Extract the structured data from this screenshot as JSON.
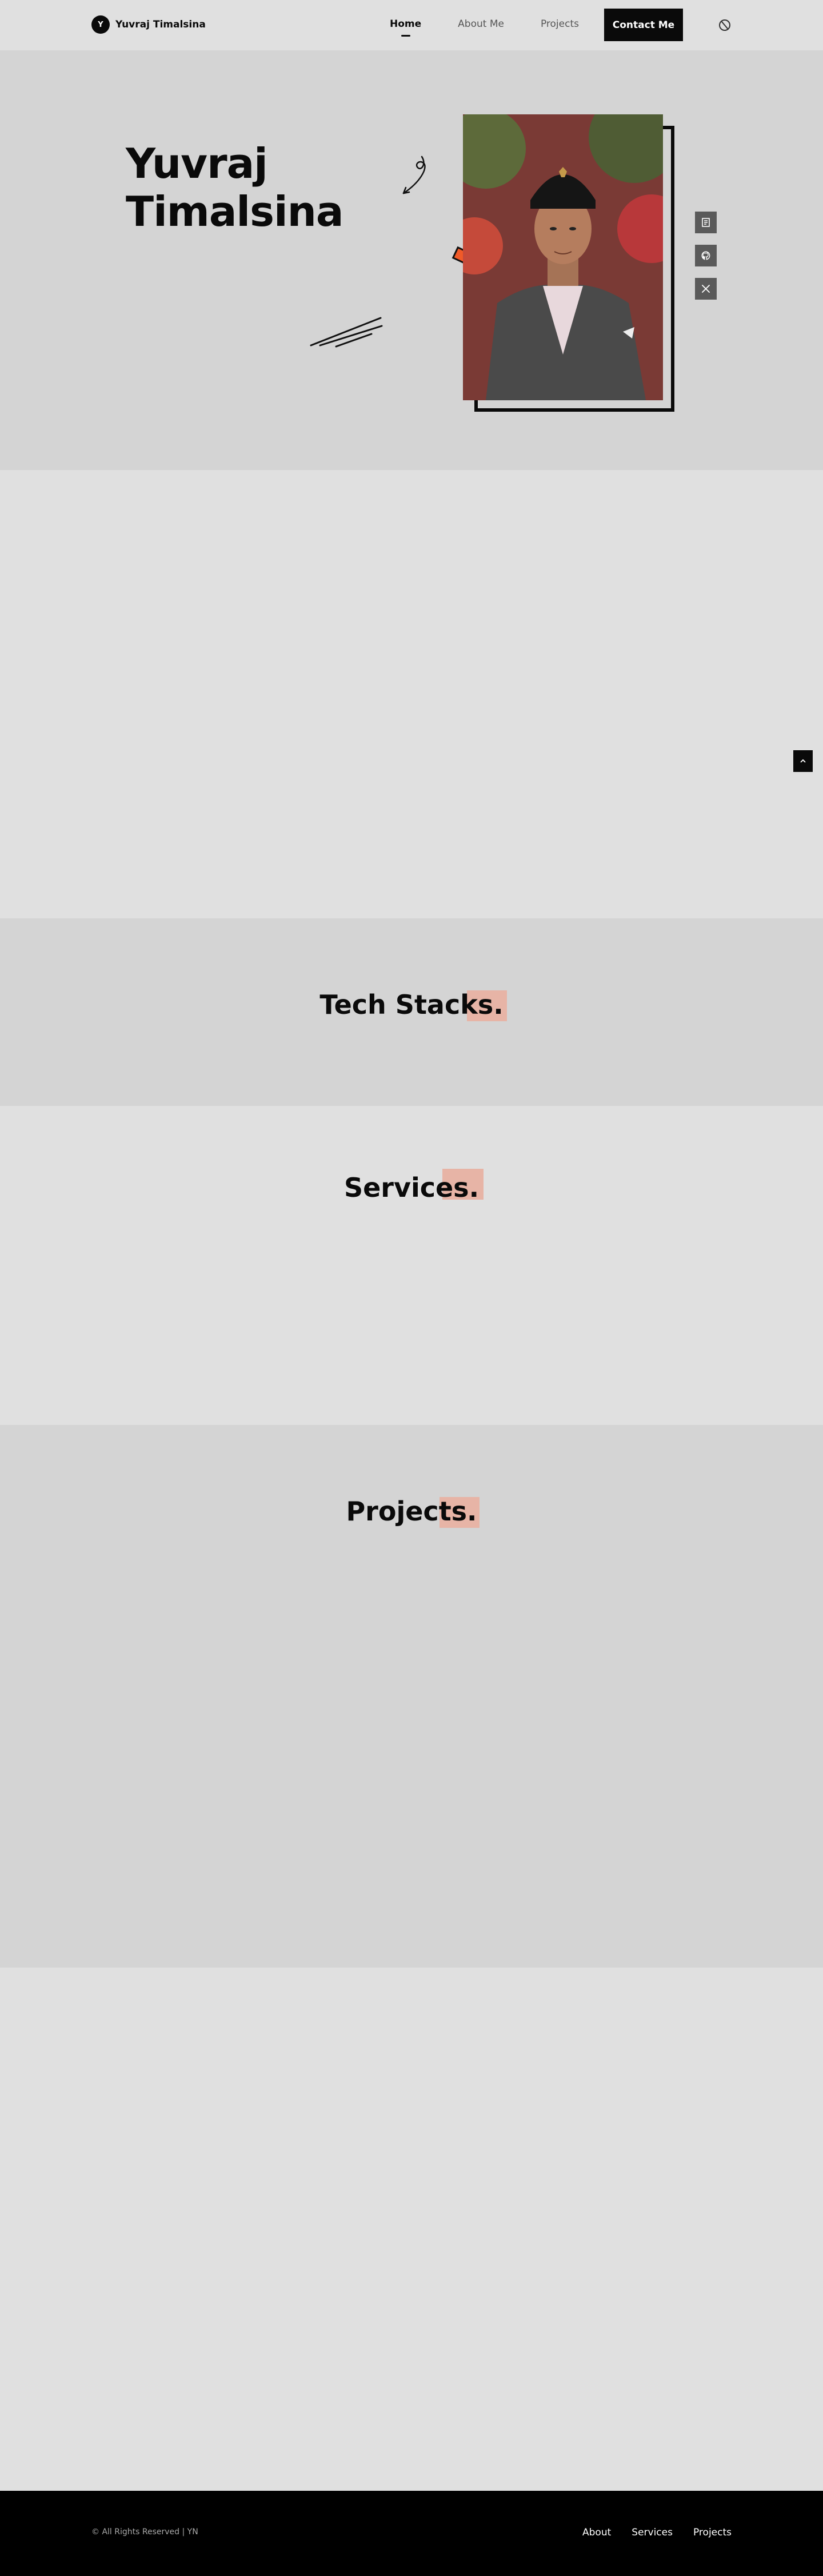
{
  "nav": {
    "logo_letter": "Y",
    "brand_name": "Yuvraj Timalsina",
    "links": [
      "Home",
      "About Me",
      "Projects"
    ],
    "contact_label": "Contact Me"
  },
  "hero": {
    "name_line1": "Yuvraj",
    "name_line2": "Timalsina",
    "socials": [
      "document-icon",
      "github-icon",
      "x-icon"
    ]
  },
  "sections": {
    "tech_stacks": "Tech Stacks.",
    "services": "Services.",
    "projects": "Projects."
  },
  "footer": {
    "copyright": "© All Rights Reserved | YN",
    "links": [
      "About",
      "Services",
      "Projects"
    ]
  },
  "colors": {
    "accent": "#e7b4a6",
    "hero_bg": "#d4d4d4",
    "page_bg": "#e0e0e0",
    "dark": "#0a0a0a"
  }
}
